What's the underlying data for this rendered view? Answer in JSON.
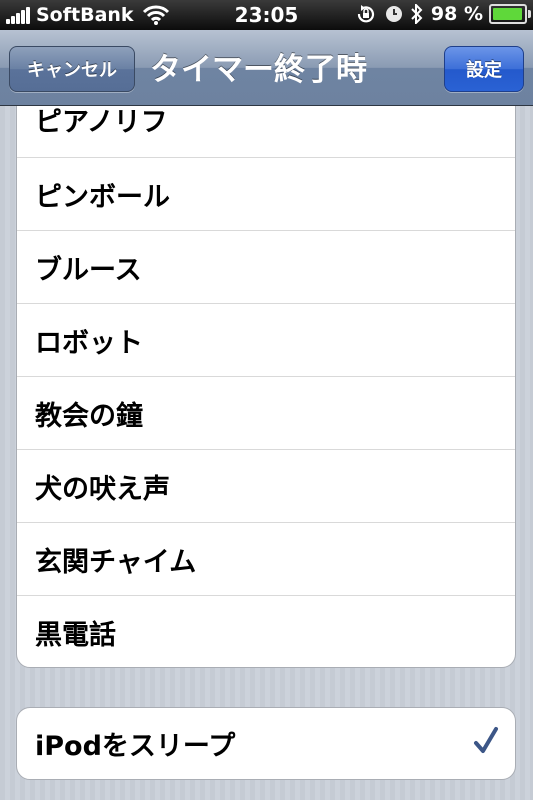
{
  "status_bar": {
    "carrier": "SoftBank",
    "time": "23:05",
    "battery_text": "98 %",
    "battery_level": 0.98,
    "battery_color": "#5fd83a"
  },
  "nav": {
    "cancel_label": "キャンセル",
    "title": "タイマー終了時",
    "set_label": "設定"
  },
  "sound_list": {
    "items": [
      {
        "label": "ピアノリフ"
      },
      {
        "label": "ピンボール"
      },
      {
        "label": "ブルース"
      },
      {
        "label": "ロボット"
      },
      {
        "label": "教会の鐘"
      },
      {
        "label": "犬の吠え声"
      },
      {
        "label": "玄関チャイム"
      },
      {
        "label": "黒電話"
      }
    ]
  },
  "sleep_option": {
    "label": "iPodをスリープ",
    "selected": true,
    "check_icon": "checkmark-icon",
    "check_color": "#3c5687"
  }
}
